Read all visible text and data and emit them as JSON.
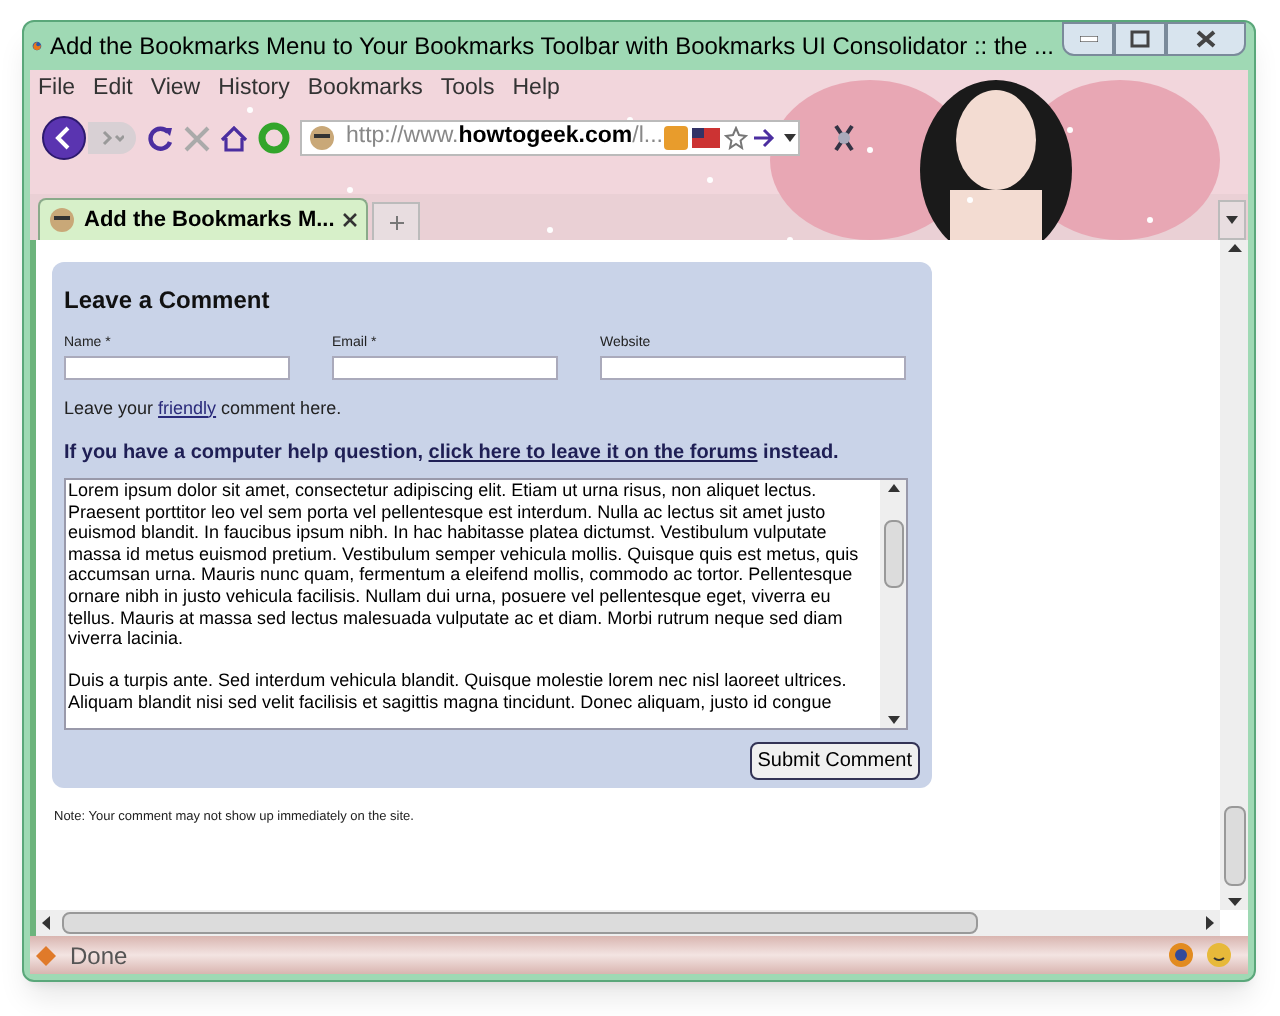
{
  "window": {
    "title": "Add the Bookmarks Menu to Your Bookmarks Toolbar with Bookmarks UI Consolidator :: the ..."
  },
  "menu": [
    "File",
    "Edit",
    "View",
    "History",
    "Bookmarks",
    "Tools",
    "Help"
  ],
  "address": {
    "prefix": "http://www.",
    "domain": "howtogeek.com",
    "suffix": "/l..."
  },
  "tabs": [
    {
      "label": "Add the Bookmarks M...",
      "selected": true
    }
  ],
  "form": {
    "heading": "Leave a Comment",
    "fields": [
      {
        "label": "Name *"
      },
      {
        "label": "Email *"
      },
      {
        "label": "Website"
      }
    ],
    "intro": {
      "before": "Leave your ",
      "link": "friendly",
      "after": " comment here."
    },
    "help": {
      "before": "If you have a computer help question, ",
      "link": "click here to leave it on the forums",
      "after": " instead."
    },
    "comment": [
      "Lorem ipsum dolor sit amet, consectetur adipiscing elit. Etiam ut urna risus, non aliquet lectus. Praesent porttitor leo vel sem porta vel pellentesque est interdum. Nulla ac lectus sit amet justo euismod blandit. In faucibus ipsum nibh. In hac habitasse platea dictumst. Vestibulum vulputate massa id metus euismod pretium. Vestibulum semper vehicula mollis. Quisque quis est metus, quis accumsan urna. Mauris nunc quam, fermentum a eleifend mollis, commodo ac tortor. Pellentesque ornare nibh in justo vehicula facilisis. Nullam dui urna, posuere vel pellentesque eget, viverra eu tellus. Mauris at massa sed lectus malesuada vulputate ac et diam. Morbi rutrum neque sed diam viverra lacinia.",
      "Duis a turpis ante. Sed interdum vehicula blandit. Quisque molestie lorem nec nisl laoreet ultrices. Aliquam blandit nisi sed velit facilisis et sagittis magna tincidunt. Donec aliquam, justo id congue"
    ],
    "submit": "Submit Comment",
    "note": "Note: Your comment may not show up immediately on the site."
  },
  "status_bar": {
    "text": "Done"
  }
}
